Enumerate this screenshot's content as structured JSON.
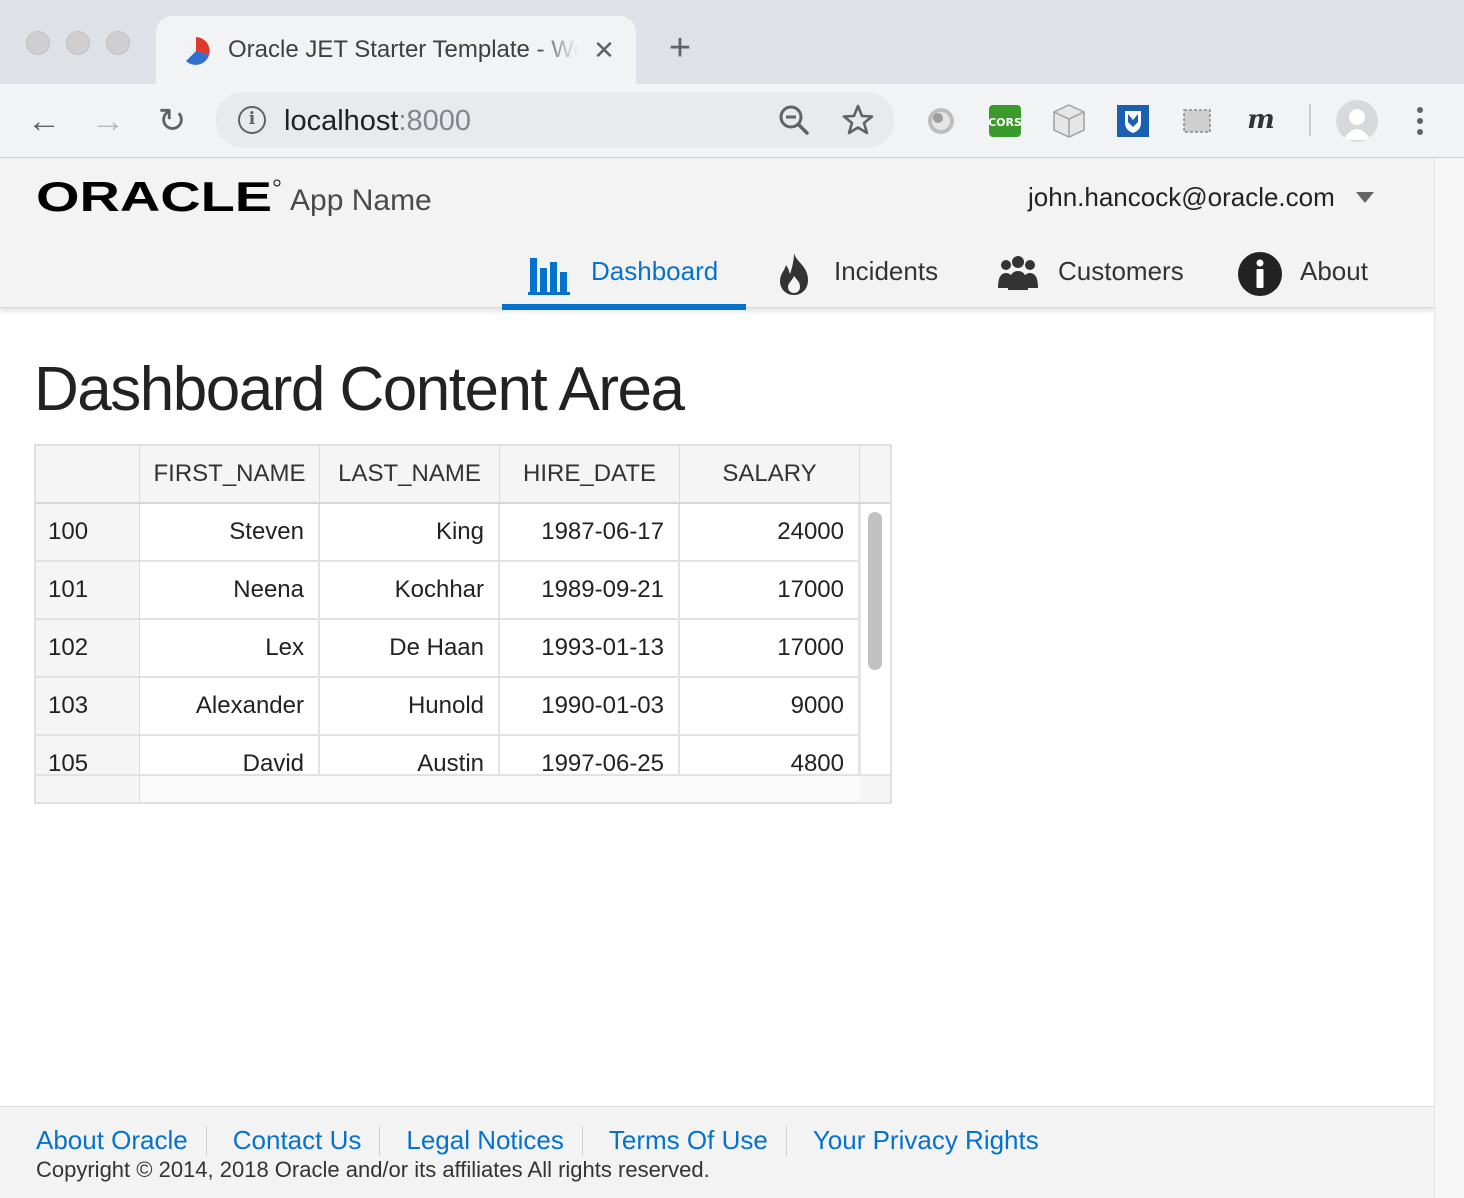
{
  "browser": {
    "tab_title": "Oracle JET Starter Template - Web Nav Bar",
    "url_host": "localhost",
    "url_port": ":8000",
    "tab_close_glyph": "✕",
    "new_tab_glyph": "+",
    "back_glyph": "←",
    "forward_glyph": "→",
    "reload_glyph": "↻",
    "extensions": [
      "grey-orb-extension-icon",
      "cors-extension-icon",
      "cube-extension-icon",
      "shield-extension-icon",
      "screenshot-extension-icon",
      "m-extension-icon"
    ],
    "cors_label": "CORS",
    "m_label": "m"
  },
  "header": {
    "logo_text": "ORACLE",
    "app_name": "App Name",
    "user": "john.hancock@oracle.com",
    "accent": "#0572ce"
  },
  "nav": [
    {
      "label": "Dashboard",
      "icon": "bar-chart-icon",
      "active": true
    },
    {
      "label": "Incidents",
      "icon": "fire-icon",
      "active": false
    },
    {
      "label": "Customers",
      "icon": "people-icon",
      "active": false
    },
    {
      "label": "About",
      "icon": "info-icon",
      "active": false
    }
  ],
  "content": {
    "title": "Dashboard Content Area"
  },
  "table": {
    "columns": [
      "FIRST_NAME",
      "LAST_NAME",
      "HIRE_DATE",
      "SALARY"
    ],
    "rows": [
      {
        "id": "100",
        "first": "Steven",
        "last": "King",
        "hire": "1987-06-17",
        "salary": "24000"
      },
      {
        "id": "101",
        "first": "Neena",
        "last": "Kochhar",
        "hire": "1989-09-21",
        "salary": "17000"
      },
      {
        "id": "102",
        "first": "Lex",
        "last": "De Haan",
        "hire": "1993-01-13",
        "salary": "17000"
      },
      {
        "id": "103",
        "first": "Alexander",
        "last": "Hunold",
        "hire": "1990-01-03",
        "salary": "9000"
      },
      {
        "id": "105",
        "first": "David",
        "last": "Austin",
        "hire": "1997-06-25",
        "salary": "4800"
      }
    ]
  },
  "footer": {
    "links": [
      "About Oracle",
      "Contact Us",
      "Legal Notices",
      "Terms Of Use",
      "Your Privacy Rights"
    ],
    "copyright": "Copyright © 2014, 2018 Oracle and/or its affiliates All rights reserved."
  }
}
